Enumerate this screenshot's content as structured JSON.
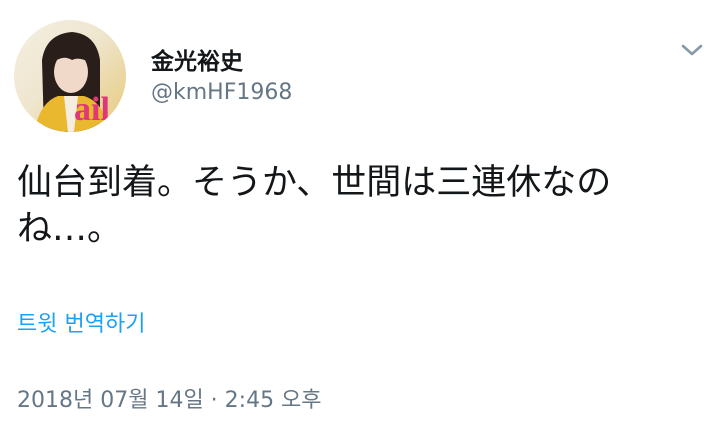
{
  "author": {
    "display_name": "金光裕史",
    "handle": "@kmHF1968",
    "avatar_text": "ail"
  },
  "tweet": {
    "text_line1": "仙台到着。そうか、世間は三連休なの",
    "text_line2": "ね…。"
  },
  "actions": {
    "translate_label": "트윗 번역하기"
  },
  "meta": {
    "timestamp": "2018년 07월 14일 · 2:45 오후"
  },
  "icons": {
    "menu": "chevron-down-icon"
  },
  "colors": {
    "link": "#1da1f2",
    "secondary_text": "#657786",
    "primary_text": "#14171a"
  }
}
